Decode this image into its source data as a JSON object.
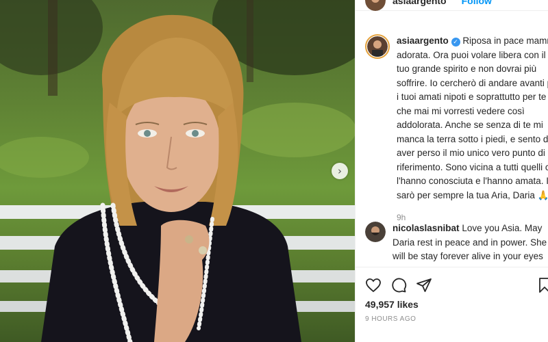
{
  "post": {
    "username": "asiaargento",
    "follow_label": "Follow"
  },
  "caption": {
    "username": "asiaargento",
    "verified_mark": "✓",
    "text": "Riposa in pace mamma adorata. Ora puoi volare libera con il tuo grande spirito e non dovrai più soffrire. Io cercherò di andare avanti per i tuoi amati nipoti e soprattutto per te che mai mi vorresti vedere così addolorata. Anche se senza di te mi manca la terra sotto i piedi, e sento di aver perso il mio unico vero punto di riferimento. Sono vicina a tutti quelli che l'hanno conosciuta e l'hanno amata. Io sarò per sempre la tua Aria, Daria 🙏💔",
    "time": "9h"
  },
  "comment": {
    "username": "nicolaslasnibat",
    "text": "Love you Asia. May Daria rest in peace and in power. She will be stay forever alive in your eyes and the eyes of"
  },
  "actions": {
    "likes": "49,957 likes",
    "posted_ago": "9 HOURS AGO"
  },
  "carousel": {
    "next_glyph": "›"
  },
  "colors": {
    "link_blue": "#0095f6",
    "verified_blue": "#3897f0",
    "story_ring": "#e4a13a",
    "text": "#262626",
    "muted": "#8e8e8e"
  },
  "icons": [
    "heart-icon",
    "comment-icon",
    "share-icon",
    "bookmark-icon",
    "carousel-next-icon",
    "verified-icon"
  ]
}
